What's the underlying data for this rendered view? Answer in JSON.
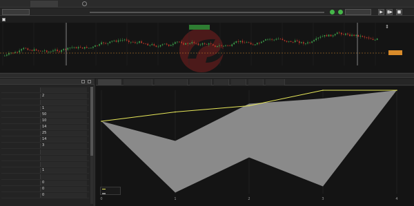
{
  "tabs": [
    {
      "label": ""
    },
    {
      "label": ""
    },
    {
      "label": ""
    }
  ],
  "toolbar": {
    "symbol": "",
    "period": "",
    "play": "▶",
    "step": "▮▶",
    "stop": "■"
  },
  "chart_header": {
    "indicator": "",
    "info_left": "",
    "info_right": ""
  },
  "price_chart": {
    "x_ticks": [
      "",
      "",
      "",
      "",
      "",
      "",
      "",
      "",
      "",
      "",
      "",
      "",
      ""
    ],
    "y_ticks": [
      "",
      "",
      "",
      "",
      "",
      ""
    ],
    "current_price": "",
    "watermark": ""
  },
  "panel": {
    "title": "",
    "params": [
      {
        "name": "",
        "value": ""
      },
      {
        "name": "",
        "value": "2"
      },
      {
        "name": "",
        "value": ""
      },
      {
        "name": "",
        "value": "1"
      },
      {
        "name": "",
        "value": "50"
      },
      {
        "name": "",
        "value": "10"
      },
      {
        "name": "",
        "value": "14"
      },
      {
        "name": "",
        "value": "25"
      },
      {
        "name": "",
        "value": "14"
      },
      {
        "name": "",
        "value": "3"
      },
      {
        "name": "",
        "value": ""
      },
      {
        "name": "",
        "value": ""
      },
      {
        "name": "",
        "value": ""
      },
      {
        "name": "",
        "value": "1"
      },
      {
        "name": "",
        "value": ""
      },
      {
        "name": "",
        "value": "0"
      },
      {
        "name": "",
        "value": "0"
      },
      {
        "name": "",
        "value": "0"
      }
    ]
  },
  "results_tabs": [
    {
      "label": ""
    },
    {
      "label": ""
    },
    {
      "label": ""
    },
    {
      "label": ""
    },
    {
      "label": ""
    },
    {
      "label": ""
    },
    {
      "label": ""
    },
    {
      "label": ""
    }
  ],
  "result_chart": {
    "y_label": "",
    "x_ticks": [
      "0",
      "1",
      "2",
      "3",
      "4"
    ],
    "legend": [
      "",
      ""
    ]
  },
  "colors": {
    "accent": "#45b649",
    "upper_line": "#e8e85a",
    "band_fill": "#8a8a8a",
    "bull_candle": "#3fa34d",
    "bear_candle": "#c0392b"
  },
  "chart_data": {
    "type": "area",
    "x": [
      0,
      1,
      2,
      3,
      4
    ],
    "series": [
      {
        "name": "",
        "values": [
          0.7,
          0.79,
          0.85,
          1.0,
          1.0
        ]
      },
      {
        "name": "",
        "values": [
          0.7,
          0.01,
          0.35,
          0.07,
          1.0
        ]
      }
    ],
    "band_upper": [
      0.7,
      0.51,
      0.87,
      0.92,
      1.0
    ],
    "band_lower": [
      0.7,
      0.01,
      0.35,
      0.07,
      1.0
    ],
    "ylim": [
      0,
      1
    ],
    "grid": true,
    "legend_position": "bottom-left"
  }
}
